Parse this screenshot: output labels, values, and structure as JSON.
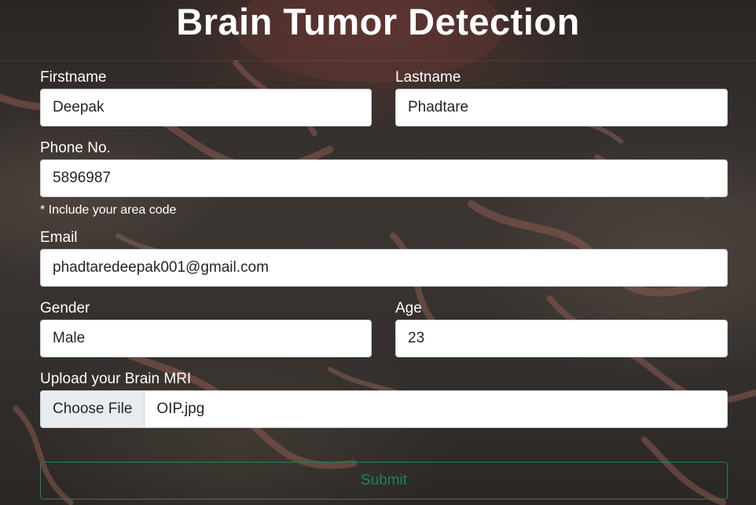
{
  "page": {
    "title": "Brain Tumor Detection"
  },
  "form": {
    "firstname": {
      "label": "Firstname",
      "value": "Deepak"
    },
    "lastname": {
      "label": "Lastname",
      "value": "Phadtare"
    },
    "phone": {
      "label": "Phone No.",
      "value": "5896987",
      "hint": "* Include your area code"
    },
    "email": {
      "label": "Email",
      "value": "phadtaredeepak001@gmail.com"
    },
    "gender": {
      "label": "Gender",
      "value": "Male"
    },
    "age": {
      "label": "Age",
      "value": "23"
    },
    "upload": {
      "label": "Upload your Brain MRI",
      "button": "Choose File",
      "filename": "OIP.jpg"
    },
    "submit": "Submit"
  },
  "colors": {
    "submit_accent": "#198754",
    "text": "#ffffff"
  }
}
